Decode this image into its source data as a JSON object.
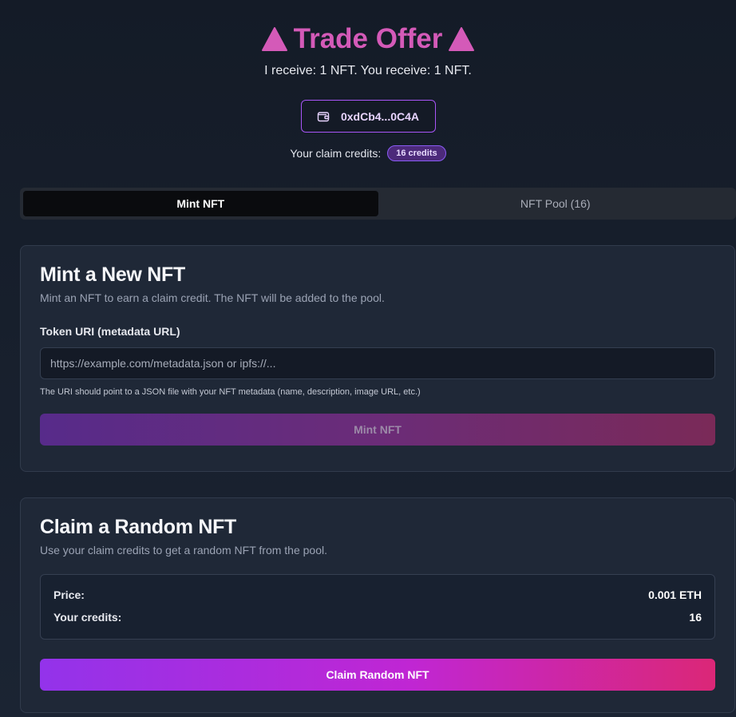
{
  "header": {
    "title": "Trade Offer",
    "subtitle": "I receive: 1 NFT. You receive: 1 NFT.",
    "accent_color": "#d45ab8"
  },
  "wallet": {
    "address": "0xdCb4...0C4A",
    "icon": "wallet-icon"
  },
  "credits": {
    "label": "Your claim credits:",
    "badge": "16 credits"
  },
  "tabs": [
    {
      "label": "Mint NFT",
      "active": true
    },
    {
      "label": "NFT Pool (16)",
      "active": false
    }
  ],
  "mint": {
    "title": "Mint a New NFT",
    "description": "Mint an NFT to earn a claim credit. The NFT will be added to the pool.",
    "field_label": "Token URI (metadata URL)",
    "placeholder": "https://example.com/metadata.json or ipfs://...",
    "value": "",
    "hint": "The URI should point to a JSON file with your NFT metadata (name, description, image URL, etc.)",
    "button": "Mint NFT"
  },
  "claim": {
    "title": "Claim a Random NFT",
    "description": "Use your claim credits to get a random NFT from the pool.",
    "price_label": "Price:",
    "price_value": "0.001 ETH",
    "credits_label": "Your credits:",
    "credits_value": "16",
    "button": "Claim Random NFT"
  }
}
